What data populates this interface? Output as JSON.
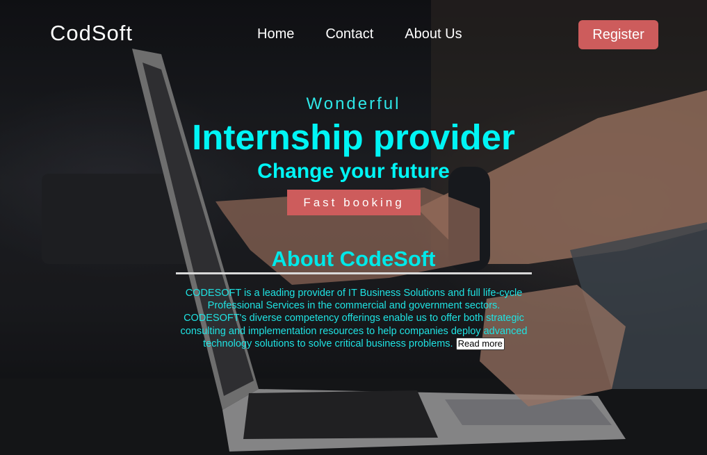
{
  "header": {
    "logo": "CodSoft",
    "nav": [
      {
        "label": "Home"
      },
      {
        "label": "Contact"
      },
      {
        "label": "About Us"
      }
    ],
    "register_label": "Register"
  },
  "hero": {
    "tagline": "Wonderful",
    "headline": "Internship provider",
    "subheadline": "Change your future",
    "cta_label": "Fast booking"
  },
  "about": {
    "title": "About CodeSoft",
    "text": "CODESOFT is a leading provider of IT Business Solutions and full life-cycle Professional Services in the commercial and government sectors. CODESOFT's diverse competency offerings enable us to offer both strategic consulting and implementation resources to help companies deploy advanced technology solutions to solve critical business problems.",
    "read_more_label": "Read more"
  },
  "colors": {
    "accent_button": "#cd5c5c",
    "heading_cyan": "#00f5f5",
    "nav_text": "#ffffff"
  }
}
